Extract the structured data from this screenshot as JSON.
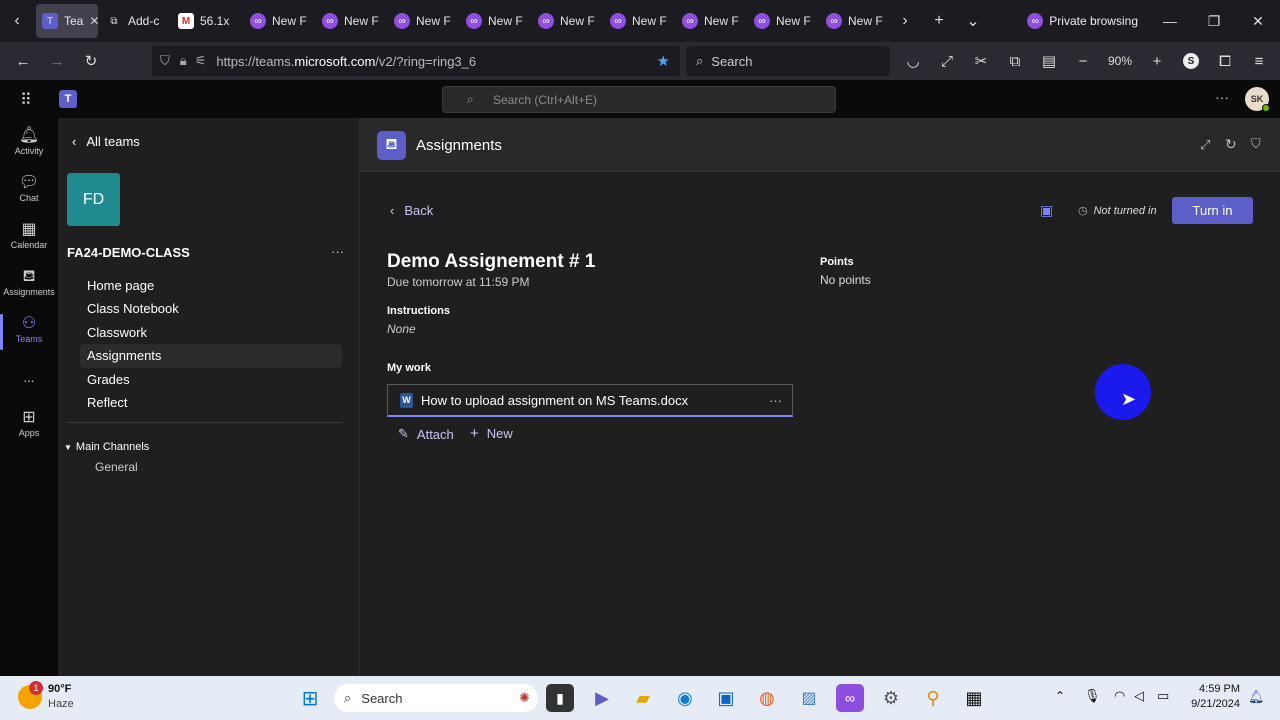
{
  "browser": {
    "tabs": [
      {
        "label": "Tea",
        "icon": "teams-icon"
      },
      {
        "label": "Add-c",
        "icon": "puzzle-icon"
      },
      {
        "label": "56.1x",
        "icon": "gmail-icon"
      },
      {
        "label": "New F",
        "icon": "private-mask-icon"
      },
      {
        "label": "New F",
        "icon": "private-mask-icon"
      },
      {
        "label": "New F",
        "icon": "private-mask-icon"
      },
      {
        "label": "New F",
        "icon": "private-mask-icon"
      },
      {
        "label": "New F",
        "icon": "private-mask-icon"
      },
      {
        "label": "New F",
        "icon": "private-mask-icon"
      },
      {
        "label": "New F",
        "icon": "private-mask-icon"
      },
      {
        "label": "New F",
        "icon": "private-mask-icon"
      },
      {
        "label": "New F",
        "icon": "private-mask-icon"
      }
    ],
    "private_label": "Private browsing",
    "url_prefix": "https://teams.",
    "url_host": "microsoft.com",
    "url_path": "/v2/?ring=ring3_6",
    "search_placeholder": "Search",
    "zoom": "90%",
    "profile_initial": "S"
  },
  "teams": {
    "search_placeholder": "Search (Ctrl+Alt+E)",
    "avatar_initials": "SK",
    "rail": [
      {
        "label": "Activity",
        "icon": "bell-icon"
      },
      {
        "label": "Chat",
        "icon": "chat-icon"
      },
      {
        "label": "Calendar",
        "icon": "calendar-icon"
      },
      {
        "label": "Assignments",
        "icon": "assignments-icon"
      },
      {
        "label": "Teams",
        "icon": "teams-icon"
      },
      {
        "label": "...",
        "icon": "more-icon"
      },
      {
        "label": "Apps",
        "icon": "apps-icon"
      }
    ],
    "all_teams": "All teams",
    "team_initials": "FD",
    "team_color": "#1f8a8f",
    "team_name": "FA24-DEMO-CLASS",
    "channels": [
      "Home page",
      "Class Notebook",
      "Classwork",
      "Assignments",
      "Grades",
      "Reflect"
    ],
    "main_channels_label": "Main Channels",
    "general_label": "General",
    "app_title": "Assignments",
    "accent": "#5b5fc7"
  },
  "assignment": {
    "back_label": "Back",
    "status": "Not turned in",
    "turn_in_label": "Turn in",
    "title": "Demo Assignement # 1",
    "due": "Due tomorrow at 11:59 PM",
    "points_label": "Points",
    "points_value": "No points",
    "instructions_label": "Instructions",
    "instructions_value": "None",
    "my_work_label": "My work",
    "file_name": "How to upload assignment on MS Teams.docx",
    "attach_label": "Attach",
    "new_label": "New"
  },
  "taskbar": {
    "temp": "90°F",
    "weather": "Haze",
    "weather_badge": "1",
    "search_label": "Search",
    "time": "4:59 PM",
    "date": "9/21/2024"
  }
}
